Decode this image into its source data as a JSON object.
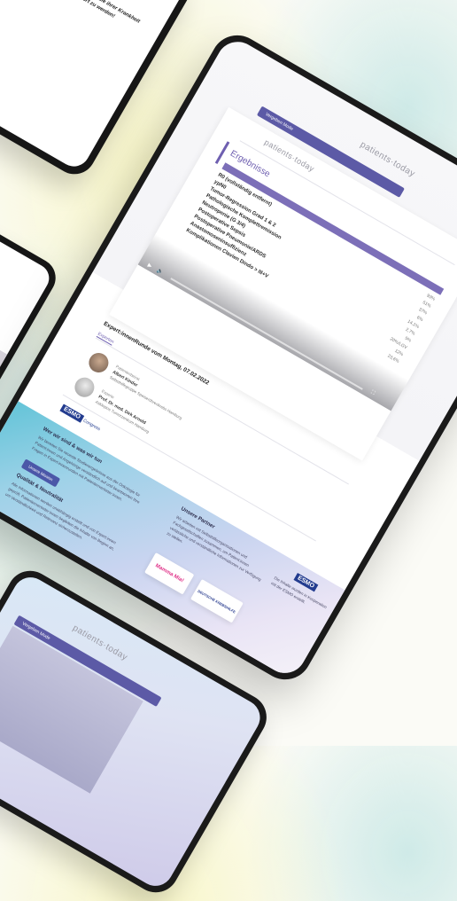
{
  "topleft_tablet": {
    "text": "Patient:innen die über die ihrer Krankheit Chance, sich gehört zu werden!"
  },
  "main_tablet": {
    "logo": "patients·today",
    "header_button": "Vergeben Mode",
    "inner_logo": "patients·today",
    "results_title": "Ergebnisse",
    "results": [
      {
        "label": "R0 (vollständig entfernt)",
        "value": "93%"
      },
      {
        "label": "ypN0",
        "value": "51%"
      },
      {
        "label": "Tumor-Regression Grad 1 & 2",
        "value": "37%"
      },
      {
        "label": "Pathologische Komplettremission",
        "value": "6%"
      },
      {
        "label": "Neutropenie (G 3/4)",
        "value": "14,1%"
      },
      {
        "label": "Postoperative Sepsis",
        "value": "2,7%"
      },
      {
        "label": "Postoperative Pneumonie/ARDS",
        "value": "5%"
      },
      {
        "label": "Anastomoseninsuffizienz",
        "value": "20%/LGV"
      },
      {
        "label": "Komplikationen Clavien Dindo > III+V",
        "value": "12%"
      }
    ],
    "last_value": "23,6%",
    "video_section_title": "Expert:innenRunde vom Montag, 07.02.2022",
    "tab_label": "Experten",
    "person1_role": "Patientenbeirat",
    "person1_name": "Albert Kinder",
    "person1_org": "Selbsthilfegruppe Speiseröhrenkrebs Hamburg",
    "person2_role": "Experte",
    "person2_name": "Prof. Dr. med. Dirk Arnold",
    "person2_org": "Asklepios Tumorzentrum Hamburg",
    "footer_logo_text": "ESMO",
    "footer_logo_sub": "Congress",
    "about_title": "Wer wir sind & was wir tun",
    "about_text": "Wir bereiten Sie neueste Studienergebnisse aus der Onkologie für Patient:innen und Angehörige verständlich auf und beantworten Ihre Fragen in Expert:innenrunden mit Patientenvertreter:innen.",
    "about_button": "Unsere Mission",
    "quality_title": "Qualität & Neutralität",
    "quality_text": "Alle Informationen werden unabhängig erstellt und von Expert:innen geprüft. Patientenvertreter:innen begleiten die Inhalte von Beginn an, um Verständlichkeit und Relevanz sicherzustellen.",
    "partner_title": "Unsere Partner",
    "partner_text": "Wir arbeiten mit Selbsthilfeorganisationen und Fachgesellschaften zusammen, um Patient:innen verlässliche und verständliche Informationen zur Verfügung zu stellen.",
    "partner1": "Mamma Mia!",
    "partner2": "DEUTSCHE KREBSHILFE",
    "esmo_text": "ESMO",
    "esmo_note": "Die Inhalte wurden in Kooperation mit der ESMO erstellt."
  },
  "bottom_tablet": {
    "logo": "patients·today",
    "header_button": "Vergeben Mode"
  }
}
